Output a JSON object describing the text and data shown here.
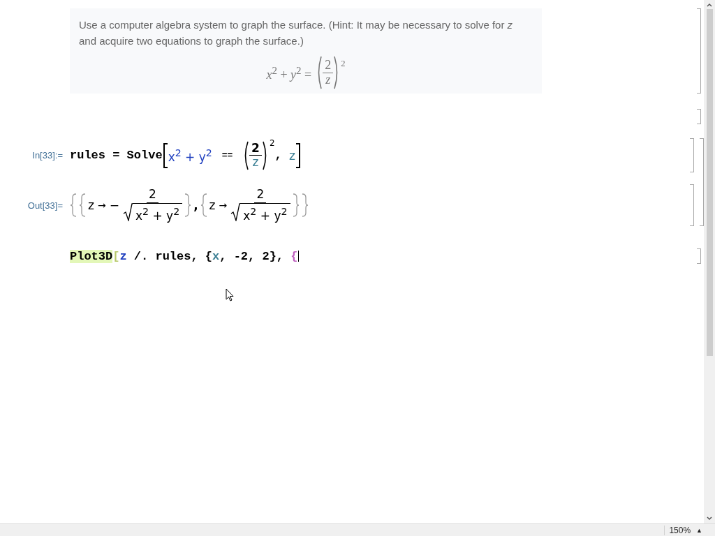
{
  "problem": {
    "text": "Use a computer algebra system to graph the surface. (Hint: It may be necessary to solve for *z* and acquire two equations to graph the surface.)",
    "equation": {
      "lhs": "*x*$^{2}$ + *y*$^{2}$ =",
      "numerator": "2",
      "denominator": "z",
      "exponent": "2"
    }
  },
  "input": {
    "label": "In[33]:=",
    "head": "rules = Solve",
    "lhs": "x$^{2}$ + y$^{2}$",
    "relation": "==",
    "numerator": "2",
    "denominator": "z",
    "exponent": "2",
    "separator": ",",
    "variable": "z"
  },
  "output": {
    "label": "Out[33]=",
    "separator": ",",
    "solutions": [
      {
        "variable": "z",
        "arrow": "→",
        "sign": "−",
        "numerator": "2",
        "radicand": "x$^{2}$ + y$^{2}$"
      },
      {
        "variable": "z",
        "arrow": "→",
        "numerator": "2",
        "radicand": "x$^{2}$ + y$^{2}$"
      }
    ]
  },
  "draft": {
    "tokens": [
      {
        "kind": "function",
        "text": "Plot3D"
      },
      {
        "kind": "open-bracket",
        "text": "["
      },
      {
        "kind": "global",
        "text": "z"
      },
      {
        "kind": "plain",
        "text": " /. rules, {"
      },
      {
        "kind": "local",
        "text": "x"
      },
      {
        "kind": "plain",
        "text": ", -2, 2}, "
      },
      {
        "kind": "unmatched",
        "text": "{"
      }
    ]
  },
  "status_bar": {
    "zoom": "150%",
    "zoom_menu": "▲"
  }
}
